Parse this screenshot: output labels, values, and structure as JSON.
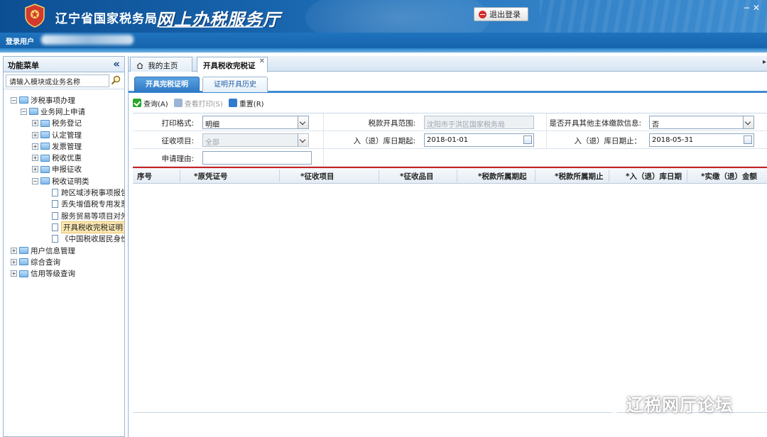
{
  "header": {
    "agency": "辽宁省国家税务局",
    "hall": "网上办税服务厅",
    "logout_label": "退出登录",
    "window_controls": "− ✕"
  },
  "userbar": {
    "label": "登录用户"
  },
  "sidebar": {
    "title": "功能菜单",
    "collapse": "«",
    "search_value": "请输入模块或业务名称",
    "tree": [
      {
        "label": "涉税事项办理",
        "depth": 0,
        "type": "folder",
        "toggle": "−"
      },
      {
        "label": "业务网上申请",
        "depth": 1,
        "type": "folder",
        "toggle": "−"
      },
      {
        "label": "税务登记",
        "depth": 2,
        "type": "folder",
        "toggle": "+"
      },
      {
        "label": "认定管理",
        "depth": 2,
        "type": "folder",
        "toggle": "+"
      },
      {
        "label": "发票管理",
        "depth": 2,
        "type": "folder",
        "toggle": "+"
      },
      {
        "label": "税收优惠",
        "depth": 2,
        "type": "folder",
        "toggle": "+"
      },
      {
        "label": "申报征收",
        "depth": 2,
        "type": "folder",
        "toggle": "+"
      },
      {
        "label": "税收证明类",
        "depth": 2,
        "type": "folder",
        "toggle": "−"
      },
      {
        "label": "跨区域涉税事项报告",
        "depth": 3,
        "type": "doc"
      },
      {
        "label": "丢失增值税专用发票",
        "depth": 3,
        "type": "doc"
      },
      {
        "label": "服务贸易等项目对外",
        "depth": 3,
        "type": "doc"
      },
      {
        "label": "开具税收完税证明（",
        "depth": 3,
        "type": "doc",
        "selected": true
      },
      {
        "label": "《中国税收居民身份",
        "depth": 3,
        "type": "doc"
      },
      {
        "label": "用户信息管理",
        "depth": 0,
        "type": "folder",
        "toggle": "+"
      },
      {
        "label": "综合查询",
        "depth": 0,
        "type": "folder",
        "toggle": "+"
      },
      {
        "label": "信用等级查询",
        "depth": 0,
        "type": "folder",
        "toggle": "+"
      }
    ]
  },
  "tabs": {
    "home": "我的主页",
    "cert": "开具税收完税证",
    "close": "✕",
    "scroll": "▸"
  },
  "subtabs": {
    "active": "开具完税证明",
    "inactive": "证明开具历史"
  },
  "toolbar": {
    "query": "查询(A)",
    "print": "查看打印(S)",
    "reset": "重置(R)"
  },
  "form": {
    "print_format_label": "打印格式:",
    "print_format_value": "明细",
    "tax_scope_label": "税款开具范围:",
    "tax_scope_value": "沈阳市于洪区国家税务局",
    "other_entity_label": "是否开具其他主体缴款信息:",
    "other_entity_value": "否",
    "levy_item_label": "征收项目:",
    "levy_item_value": "全部",
    "date_from_label": "入（退）库日期起:",
    "date_from_value": "2018-01-01",
    "date_to_label": "入（退）库日期止：",
    "date_to_value": "2018-05-31",
    "reason_label": "申请理由:",
    "reason_value": ""
  },
  "grid": {
    "columns": [
      "序号",
      "*原凭证号",
      "*征收项目",
      "*征收品目",
      "*税款所属期起",
      "*税款所属期止",
      "*入（退）库日期",
      "*实缴（退）金额"
    ]
  },
  "watermark": {
    "text": "辽税网厅论坛"
  },
  "colors": {
    "header_blue": "#1764ad",
    "subtab_active": "#2d78c4",
    "grid_rule": "#cc2222",
    "selected_bg": "#fbe7b0"
  }
}
